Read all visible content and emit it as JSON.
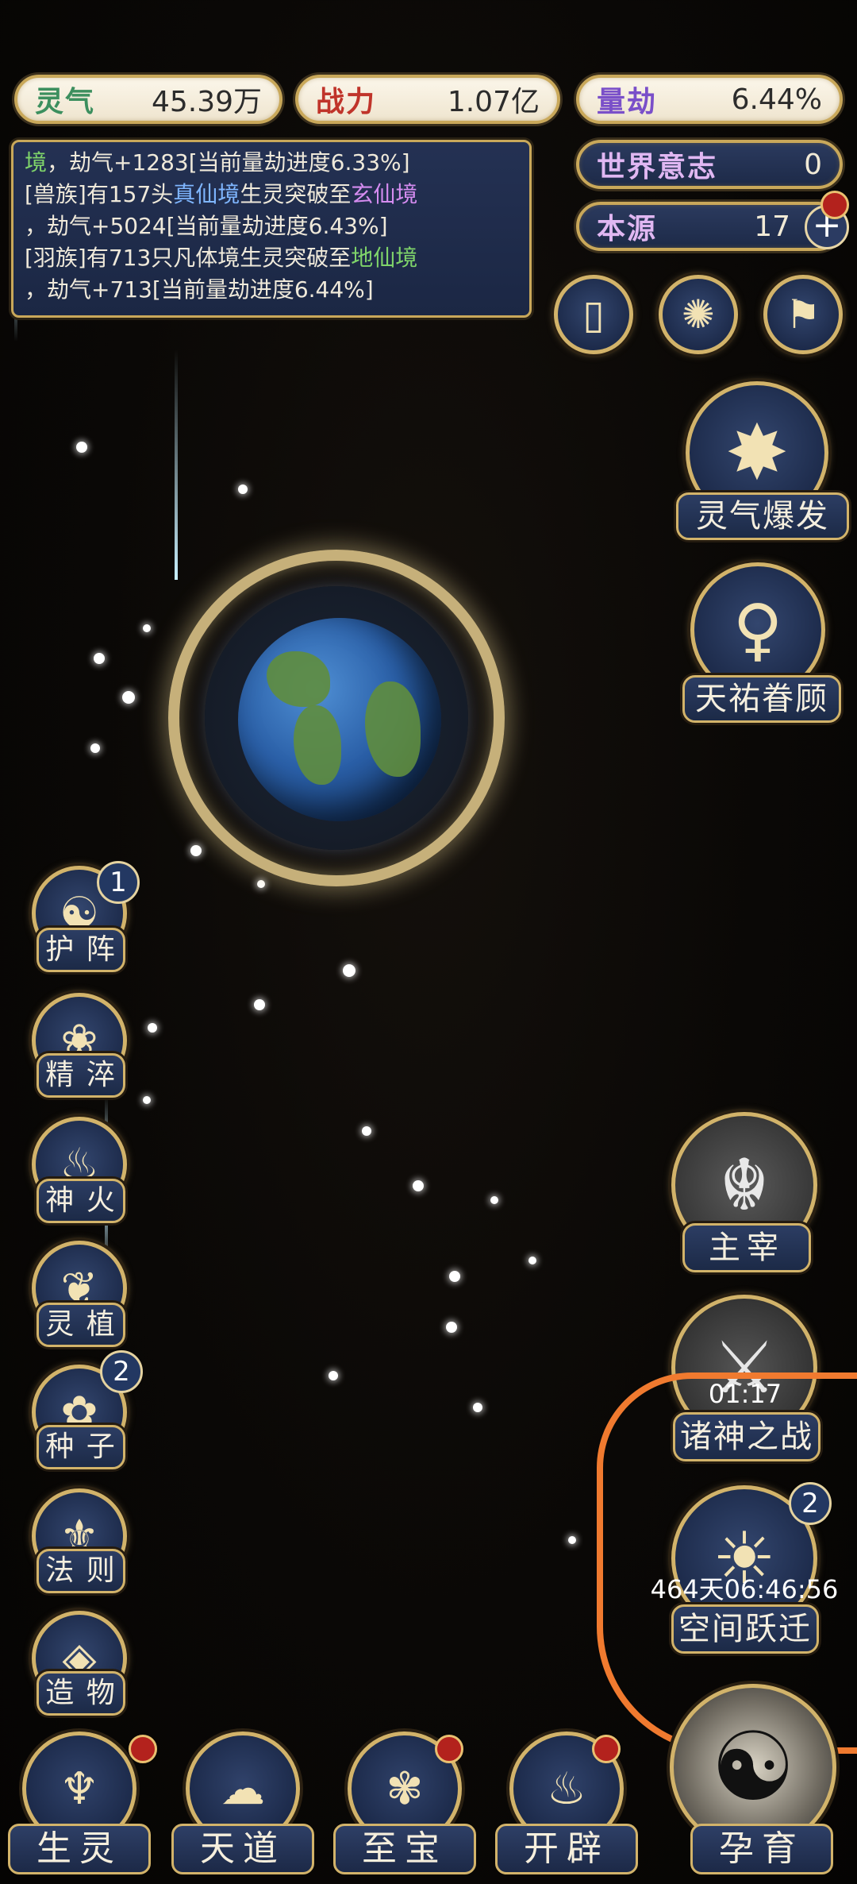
{
  "stats": {
    "lingqi": {
      "label": "灵气",
      "value": "45.39万"
    },
    "zhanli": {
      "label": "战力",
      "value": "1.07亿"
    },
    "liangjie": {
      "label": "量劫",
      "value": "6.44%"
    },
    "world_will": {
      "label": "世界意志",
      "value": "0"
    },
    "origin": {
      "label": "本源",
      "value": "17"
    }
  },
  "log": {
    "line1_a": "境",
    "line1_b": "，劫气+1283[当前量劫进度6.33%]",
    "line2_a": "[兽族]有157头",
    "line2_b": "真仙境",
    "line2_c": "生灵突破至",
    "line2_d": "玄仙境",
    "line3": "，劫气+5024[当前量劫进度6.43%]",
    "line4_a": "[羽族]有713只凡体境生灵突破至",
    "line4_b": "地仙境",
    "line5": "，劫气+713[当前量劫进度6.44%]"
  },
  "right_actions": {
    "burst": "灵气爆发",
    "blessing": "天祐眷顾",
    "master": "主宰",
    "godwar": "诸神之战",
    "godwar_timer": "01:17",
    "jump": "空间跃迁",
    "jump_timer": "464天06:46:56",
    "jump_badge": "2"
  },
  "left_menu": [
    {
      "label": "护 阵",
      "badge": "1",
      "icon": "taiji-icon"
    },
    {
      "label": "精 淬",
      "badge": "",
      "icon": "lotus-flame-icon"
    },
    {
      "label": "神 火",
      "badge": "",
      "icon": "fire-icon"
    },
    {
      "label": "灵 植",
      "badge": "",
      "icon": "plant-icon"
    },
    {
      "label": "种 子",
      "badge": "2",
      "icon": "flower-icon"
    },
    {
      "label": "法 则",
      "badge": "",
      "icon": "rune-icon"
    },
    {
      "label": "造 物",
      "badge": "",
      "icon": "diamond-icon"
    }
  ],
  "bottom_nav": [
    {
      "label": "生灵"
    },
    {
      "label": "天道"
    },
    {
      "label": "至宝"
    },
    {
      "label": "开辟"
    },
    {
      "label": "孕育"
    }
  ],
  "colors": {
    "gold": "#d2b36a",
    "navy": "#1d2b4b",
    "highlight_orange": "#f07a2f"
  }
}
